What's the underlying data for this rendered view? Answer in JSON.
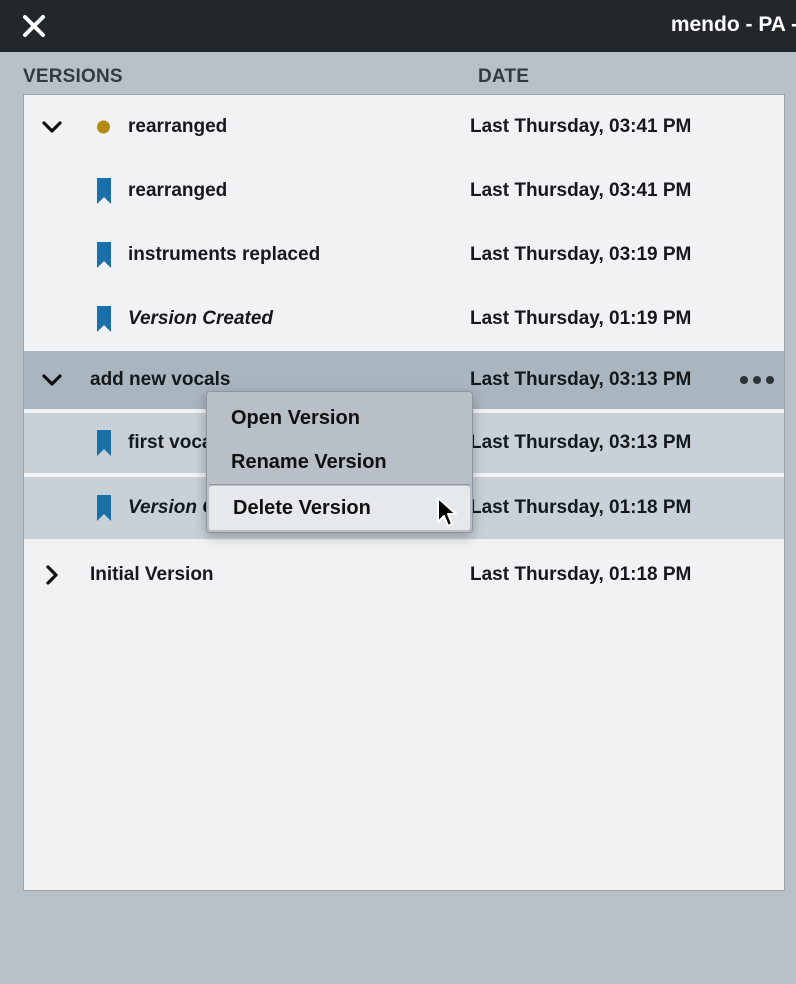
{
  "window": {
    "title": "mendo - PA -"
  },
  "columns": {
    "versions": "VERSIONS",
    "date": "DATE"
  },
  "rows": [
    {
      "label": "rearranged",
      "date": "Last Thursday, 03:41 PM",
      "icon": "status-dot",
      "expander": "chevron-down"
    },
    {
      "label": "rearranged",
      "date": "Last Thursday, 03:41 PM",
      "icon": "bookmark"
    },
    {
      "label": "instruments replaced",
      "date": "Last Thursday, 03:19 PM",
      "icon": "bookmark"
    },
    {
      "label": "Version Created",
      "date": "Last Thursday, 01:19 PM",
      "icon": "bookmark"
    },
    {
      "label": "add new vocals",
      "date": "Last Thursday, 03:13 PM",
      "expander": "chevron-down",
      "selected": true,
      "more": "more-options"
    },
    {
      "label": "first voca",
      "date": "Last Thursday, 03:13 PM",
      "icon": "bookmark"
    },
    {
      "label": "Version C",
      "date": "Last Thursday, 01:18 PM",
      "icon": "bookmark"
    },
    {
      "label": "Initial Version",
      "date": "Last Thursday, 01:18 PM",
      "expander": "chevron-right"
    }
  ],
  "context_menu": {
    "items": [
      "Open Version",
      "Rename Version",
      "Delete Version"
    ],
    "hovered": "Delete Version"
  },
  "colors": {
    "titlebar": "#22272b",
    "background": "#b9c1c8",
    "bookmark": "#1a6fa8",
    "status_dot": "#b68a16",
    "selected_row": "#a9b5bf"
  }
}
